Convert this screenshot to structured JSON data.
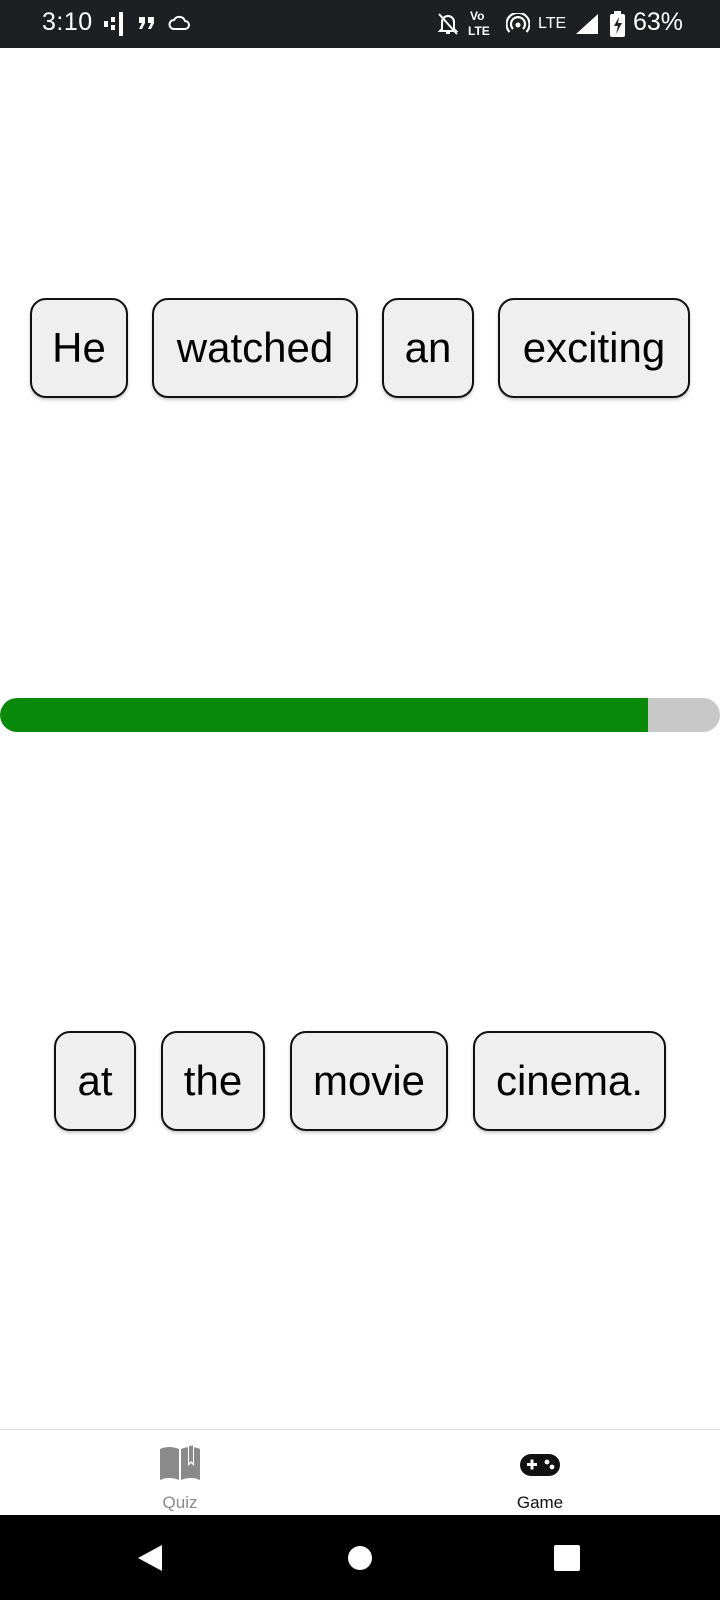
{
  "status_bar": {
    "time": "3:10",
    "volte_top": "Vo",
    "volte_bottom": "LTE",
    "lte": "LTE",
    "battery": "63%",
    "icons": [
      "signal-bars-icon",
      "quote-icon",
      "cloud-icon",
      "bell-off-icon",
      "hotspot-icon",
      "cell-signal-icon",
      "battery-charging-icon"
    ]
  },
  "game": {
    "top_words": [
      "He",
      "watched",
      "an",
      "exciting"
    ],
    "bottom_words": [
      "at",
      "the",
      "movie",
      "cinema."
    ],
    "progress_fraction": 0.9
  },
  "bottom_nav": {
    "items": [
      {
        "label": "Quiz",
        "icon": "book-icon",
        "active": false
      },
      {
        "label": "Game",
        "icon": "gamepad-icon",
        "active": true
      }
    ]
  },
  "system_nav": [
    "back-icon",
    "home-icon",
    "recents-icon"
  ],
  "colors": {
    "progress": "#0a8a0a",
    "track": "#c8c8c8",
    "tile": "#efefef",
    "status_bar": "#1d1f23"
  }
}
